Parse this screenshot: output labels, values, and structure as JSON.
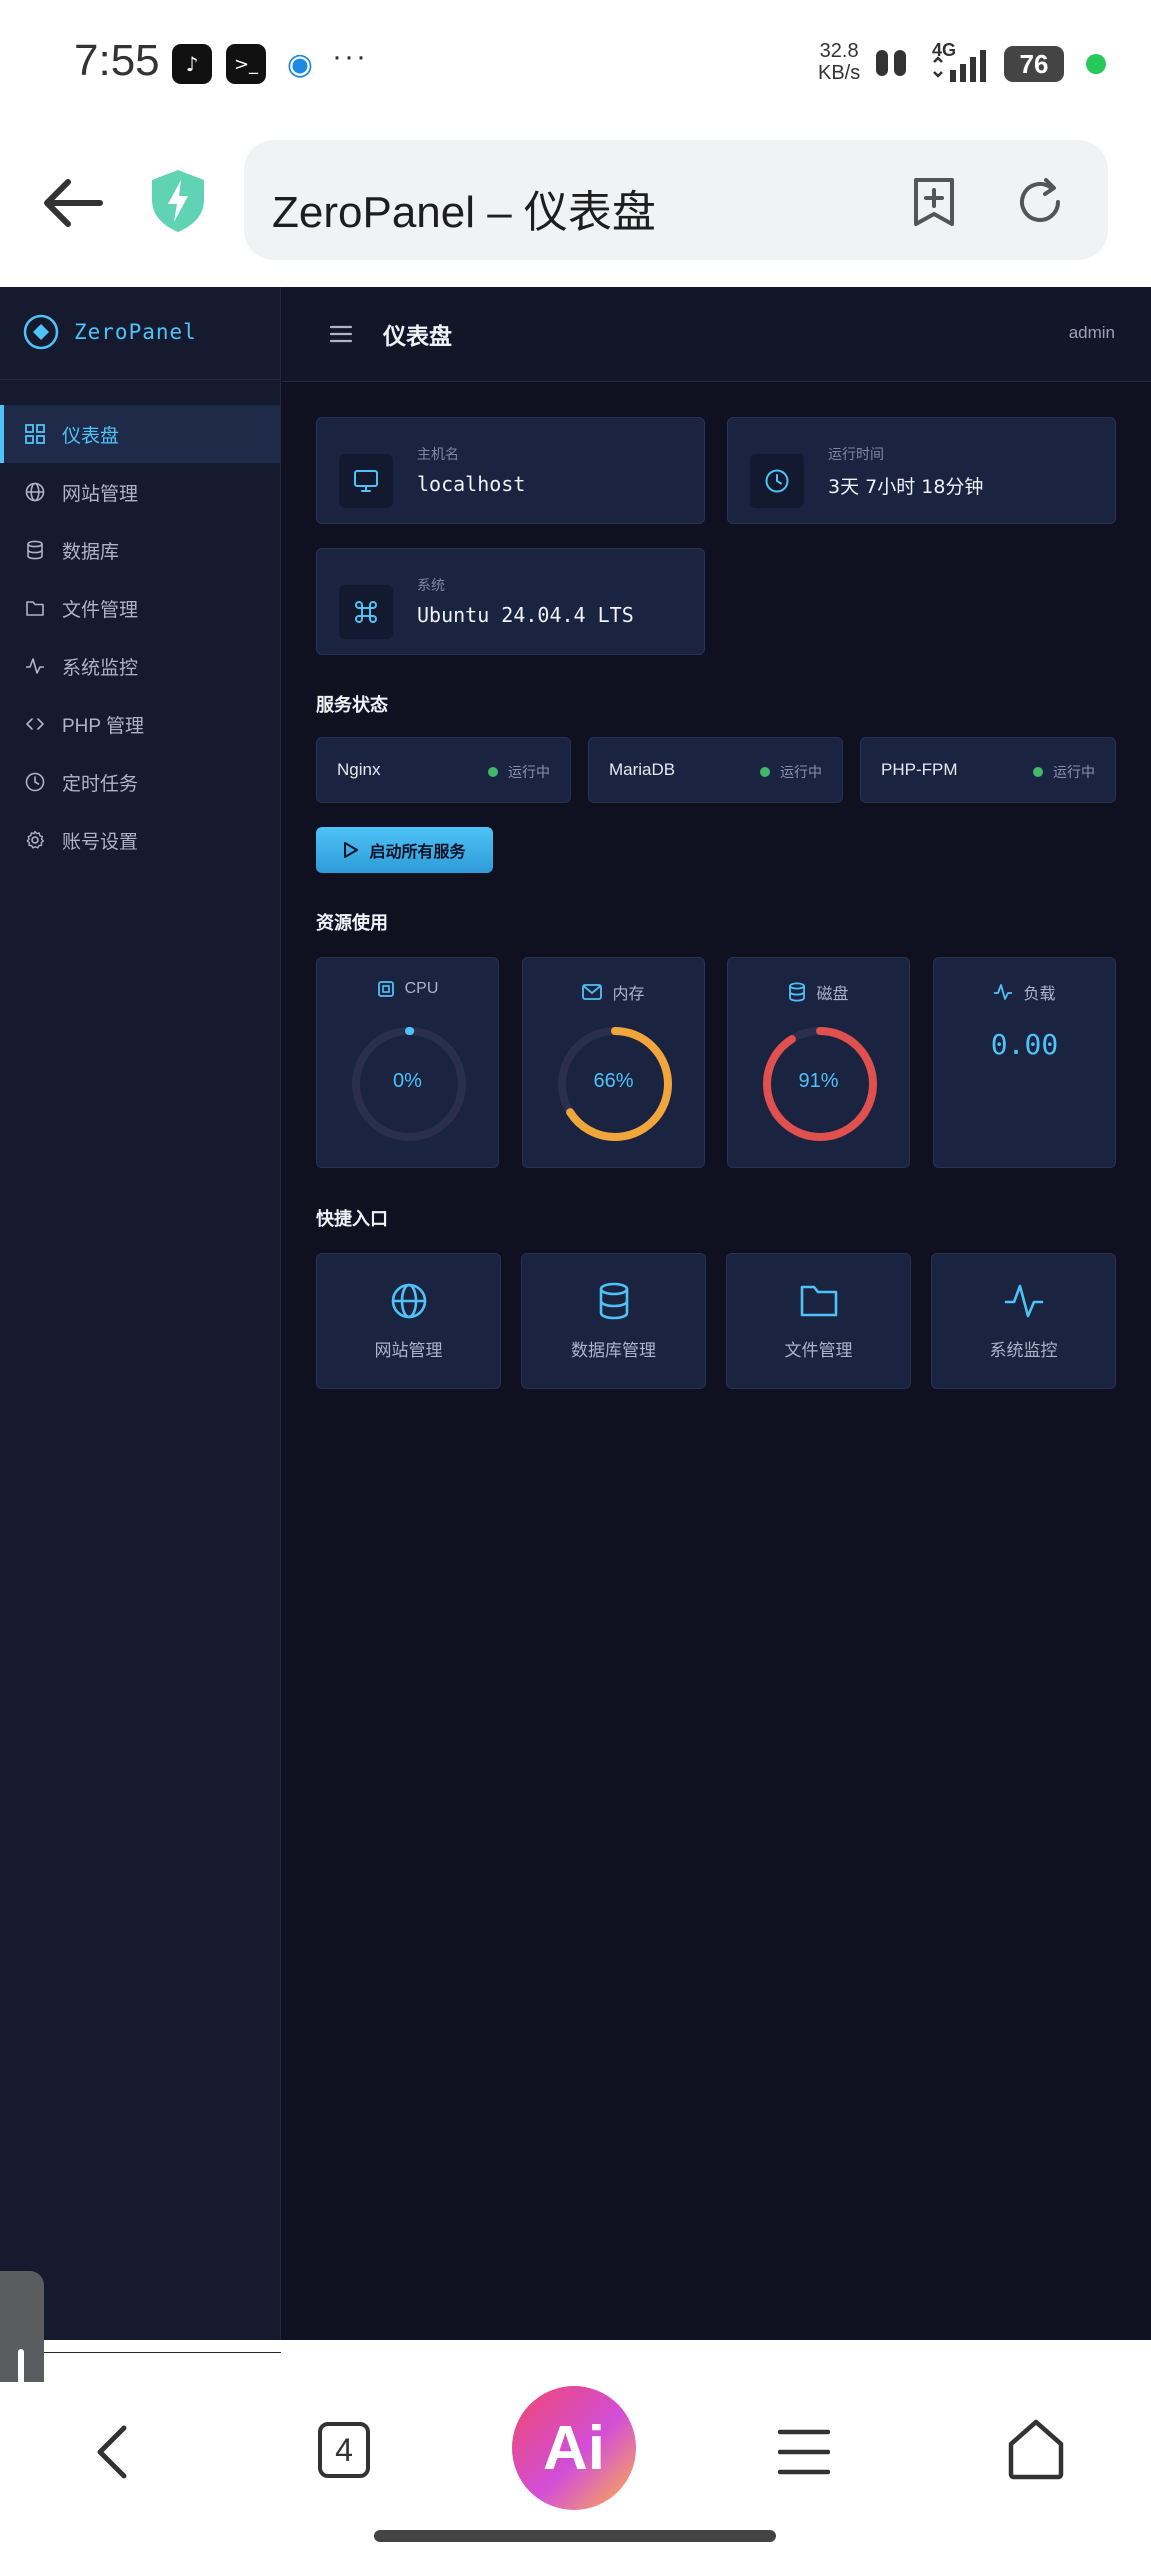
{
  "status_bar": {
    "time": "7:55",
    "net_speed_value": "32.8",
    "net_speed_unit": "KB/s",
    "signal": "4G",
    "battery": "76",
    "more": "···"
  },
  "browser": {
    "url_title": "ZeroPanel – 仪表盘",
    "tab_count": "4",
    "ai_label": "Ai"
  },
  "sidebar": {
    "brand": "ZeroPanel",
    "items": [
      {
        "label": "仪表盘",
        "icon": "grid-icon",
        "active": true
      },
      {
        "label": "网站管理",
        "icon": "globe-icon"
      },
      {
        "label": "数据库",
        "icon": "database-icon"
      },
      {
        "label": "文件管理",
        "icon": "folder-icon"
      },
      {
        "label": "系统监控",
        "icon": "activity-icon"
      },
      {
        "label": "PHP 管理",
        "icon": "code-icon"
      },
      {
        "label": "定时任务",
        "icon": "clock-icon"
      },
      {
        "label": "账号设置",
        "icon": "gear-icon"
      }
    ]
  },
  "header": {
    "title": "仪表盘",
    "user": "admin"
  },
  "info": {
    "hostname": {
      "label": "主机名",
      "value": "localhost"
    },
    "uptime": {
      "label": "运行时间",
      "value": "3天 7小时 18分钟"
    },
    "system": {
      "label": "系统",
      "value": "Ubuntu 24.04.4 LTS"
    }
  },
  "services": {
    "title": "服务状态",
    "items": [
      {
        "name": "Nginx",
        "status": "运行中"
      },
      {
        "name": "MariaDB",
        "status": "运行中"
      },
      {
        "name": "PHP-FPM",
        "status": "运行中"
      }
    ],
    "start_all": "启动所有服务"
  },
  "resources": {
    "title": "资源使用",
    "cpu": {
      "label": "CPU",
      "value": "0%",
      "percent": 0,
      "color": "#4fc3f7"
    },
    "memory": {
      "label": "内存",
      "value": "66%",
      "percent": 66,
      "color": "#f0a63a"
    },
    "disk": {
      "label": "磁盘",
      "value": "91%",
      "percent": 91,
      "color": "#e0504f"
    },
    "load": {
      "label": "负载",
      "value": "0.00"
    }
  },
  "quick": {
    "title": "快捷入口",
    "items": [
      {
        "label": "网站管理",
        "icon": "globe-icon"
      },
      {
        "label": "数据库管理",
        "icon": "database-icon"
      },
      {
        "label": "文件管理",
        "icon": "folder-icon"
      },
      {
        "label": "系统监控",
        "icon": "activity-icon"
      }
    ]
  },
  "colors": {
    "accent": "#4fc3f7",
    "background": "#0f1020",
    "card": "#1a2340",
    "running": "#43b86a"
  }
}
